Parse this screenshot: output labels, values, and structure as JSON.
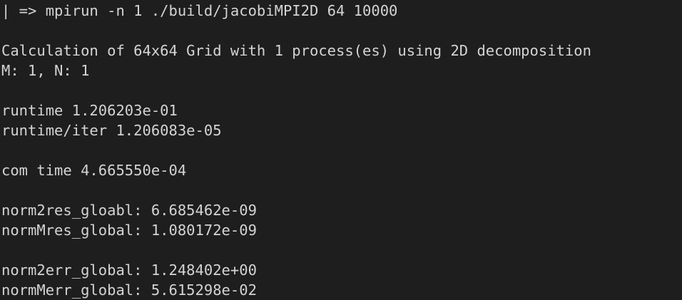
{
  "terminal": {
    "prompt_line": "| => mpirun -n 1 ./build/jacobiMPI2D 64 10000",
    "calc_line": "Calculation of 64x64 Grid with 1 process(es) using 2D decomposition",
    "mn_line": "M: 1, N: 1",
    "runtime_line": "runtime 1.206203e-01",
    "runtime_iter_line": "runtime/iter 1.206083e-05",
    "com_time_line": "com time 4.665550e-04",
    "norm2res_line": "norm2res_gloabl: 6.685462e-09",
    "normMres_line": "normMres_global: 1.080172e-09",
    "norm2err_line": "norm2err_global: 1.248402e+00",
    "normMerr_line": "normMerr_global: 5.615298e-02"
  }
}
